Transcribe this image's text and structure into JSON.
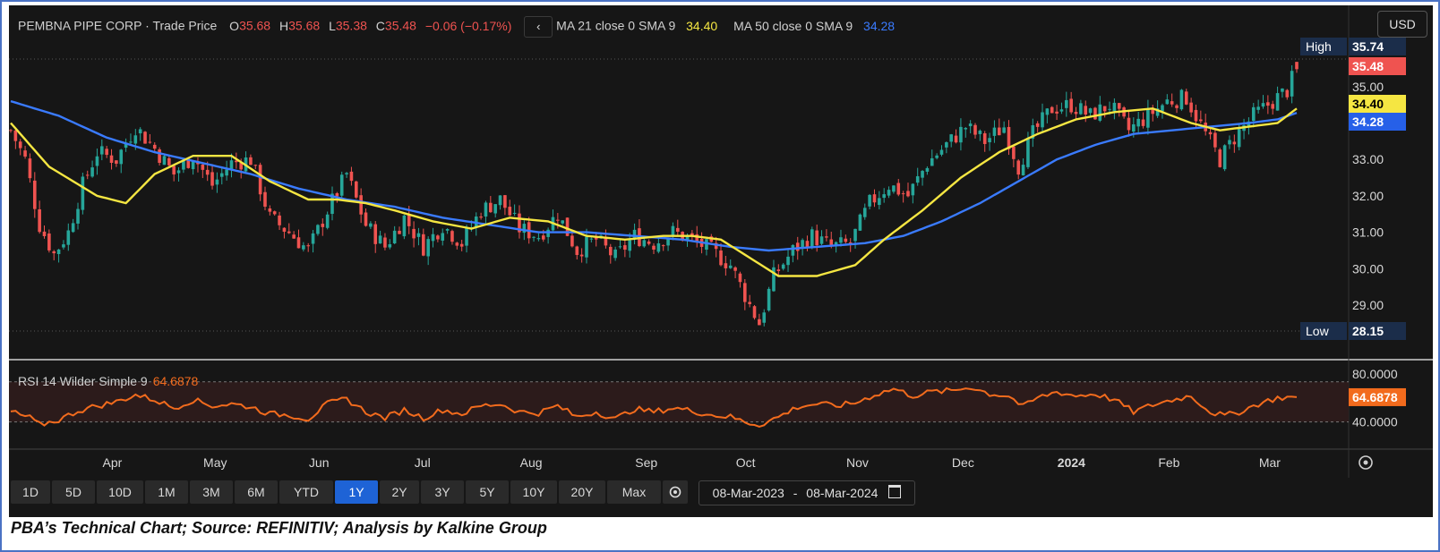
{
  "header": {
    "symbol": "PEMBNA PIPE CORP",
    "price_type": "Trade Price",
    "open_label": "O",
    "open": "35.68",
    "high_label": "H",
    "high": "35.68",
    "low_label": "L",
    "low": "35.38",
    "close_label": "C",
    "close": "35.48",
    "change": "−0.06 (−0.17%)",
    "ma21_label": "MA 21 close 0 SMA 9",
    "ma21_value": "34.40",
    "ma50_label": "MA 50 close 0 SMA 9",
    "ma50_value": "34.28",
    "collapse_glyph": "‹"
  },
  "currency": "USD",
  "price_tags": {
    "high_label": "High",
    "high_value": "35.74",
    "last_value": "35.48",
    "ma21_value": "34.40",
    "ma50_value": "34.28",
    "low_label": "Low",
    "low_value": "28.15"
  },
  "rsi": {
    "label": "RSI 14 Wilder Simple 9",
    "value": "64.6878",
    "upper": "80.0000",
    "lower": "40.0000"
  },
  "toolbar": {
    "ranges": [
      "1D",
      "5D",
      "10D",
      "1M",
      "3M",
      "6M",
      "YTD",
      "1Y",
      "2Y",
      "3Y",
      "5Y",
      "10Y",
      "20Y",
      "Max"
    ],
    "active": "1Y"
  },
  "date_range": {
    "from": "08-Mar-2023",
    "sep": "-",
    "to": "08-Mar-2024"
  },
  "caption": "PBA’s Technical Chart; Source: REFINITIV; Analysis by Kalkine Group",
  "colors": {
    "up": "#26a69a",
    "down": "#ef5350",
    "ma21": "#f5e642",
    "ma50": "#3a7bff",
    "rsi": "#f26b1d",
    "background": "#161616"
  },
  "chart_data": {
    "type": "candlestick",
    "y_ticks": [
      "35.00",
      "34.00",
      "33.00",
      "32.00",
      "31.00",
      "30.00",
      "29.00"
    ],
    "ylim": [
      27.6,
      36.2
    ],
    "x_months": [
      "Apr",
      "May",
      "Jun",
      "Jul",
      "Aug",
      "Sep",
      "Oct",
      "Nov",
      "Dec",
      "2024",
      "Feb",
      "Mar"
    ],
    "price_path": [
      [
        0,
        33.8
      ],
      [
        3,
        33.0
      ],
      [
        6,
        31.2
      ],
      [
        9,
        30.4
      ],
      [
        12,
        31.0
      ],
      [
        15,
        32.3
      ],
      [
        18,
        33.2
      ],
      [
        22,
        33.0
      ],
      [
        26,
        33.9
      ],
      [
        30,
        33.3
      ],
      [
        34,
        32.6
      ],
      [
        38,
        33.1
      ],
      [
        42,
        32.3
      ],
      [
        46,
        32.9
      ],
      [
        50,
        33.0
      ],
      [
        54,
        31.4
      ],
      [
        58,
        31.0
      ],
      [
        62,
        30.5
      ],
      [
        66,
        31.6
      ],
      [
        70,
        32.6
      ],
      [
        74,
        31.2
      ],
      [
        78,
        30.6
      ],
      [
        82,
        31.4
      ],
      [
        86,
        30.6
      ],
      [
        90,
        31.2
      ],
      [
        94,
        30.7
      ],
      [
        98,
        31.6
      ],
      [
        102,
        31.9
      ],
      [
        106,
        31.1
      ],
      [
        110,
        30.9
      ],
      [
        114,
        31.5
      ],
      [
        118,
        30.5
      ],
      [
        122,
        30.8
      ],
      [
        126,
        30.3
      ],
      [
        130,
        30.9
      ],
      [
        134,
        30.7
      ],
      [
        138,
        31.0
      ],
      [
        142,
        30.8
      ],
      [
        146,
        30.5
      ],
      [
        150,
        30.1
      ],
      [
        154,
        29.0
      ],
      [
        156,
        28.5
      ],
      [
        159,
        29.8
      ],
      [
        163,
        30.5
      ],
      [
        167,
        30.9
      ],
      [
        171,
        30.6
      ],
      [
        175,
        30.7
      ],
      [
        179,
        31.8
      ],
      [
        183,
        32.3
      ],
      [
        187,
        32.0
      ],
      [
        191,
        32.9
      ],
      [
        195,
        33.4
      ],
      [
        199,
        33.9
      ],
      [
        203,
        33.5
      ],
      [
        207,
        33.9
      ],
      [
        210,
        32.8
      ],
      [
        213,
        33.7
      ],
      [
        217,
        34.4
      ],
      [
        221,
        34.5
      ],
      [
        225,
        34.2
      ],
      [
        229,
        34.5
      ],
      [
        233,
        33.8
      ],
      [
        237,
        34.2
      ],
      [
        241,
        34.6
      ],
      [
        245,
        34.7
      ],
      [
        249,
        33.7
      ],
      [
        252,
        33.0
      ],
      [
        255,
        33.6
      ],
      [
        259,
        34.2
      ],
      [
        263,
        34.6
      ],
      [
        266,
        34.9
      ],
      [
        268,
        35.48
      ]
    ],
    "ma21_path": [
      [
        0,
        34.0
      ],
      [
        8,
        32.8
      ],
      [
        18,
        32.0
      ],
      [
        24,
        31.8
      ],
      [
        30,
        32.6
      ],
      [
        38,
        33.1
      ],
      [
        46,
        33.1
      ],
      [
        54,
        32.4
      ],
      [
        62,
        31.9
      ],
      [
        68,
        31.9
      ],
      [
        74,
        31.8
      ],
      [
        80,
        31.6
      ],
      [
        88,
        31.3
      ],
      [
        96,
        31.1
      ],
      [
        104,
        31.4
      ],
      [
        112,
        31.3
      ],
      [
        120,
        30.9
      ],
      [
        128,
        30.8
      ],
      [
        136,
        30.9
      ],
      [
        142,
        30.9
      ],
      [
        148,
        30.8
      ],
      [
        154,
        30.3
      ],
      [
        160,
        29.8
      ],
      [
        168,
        29.8
      ],
      [
        176,
        30.1
      ],
      [
        182,
        30.8
      ],
      [
        190,
        31.6
      ],
      [
        198,
        32.5
      ],
      [
        206,
        33.2
      ],
      [
        214,
        33.7
      ],
      [
        222,
        34.1
      ],
      [
        230,
        34.3
      ],
      [
        238,
        34.4
      ],
      [
        246,
        34.0
      ],
      [
        252,
        33.8
      ],
      [
        258,
        33.9
      ],
      [
        264,
        34.0
      ],
      [
        268,
        34.4
      ]
    ],
    "ma50_path": [
      [
        0,
        34.6
      ],
      [
        10,
        34.2
      ],
      [
        20,
        33.6
      ],
      [
        30,
        33.2
      ],
      [
        40,
        32.9
      ],
      [
        50,
        32.6
      ],
      [
        60,
        32.2
      ],
      [
        70,
        31.9
      ],
      [
        80,
        31.7
      ],
      [
        90,
        31.4
      ],
      [
        100,
        31.2
      ],
      [
        110,
        31.0
      ],
      [
        120,
        31.0
      ],
      [
        130,
        30.9
      ],
      [
        140,
        30.8
      ],
      [
        150,
        30.6
      ],
      [
        158,
        30.5
      ],
      [
        168,
        30.6
      ],
      [
        178,
        30.7
      ],
      [
        186,
        30.9
      ],
      [
        194,
        31.3
      ],
      [
        202,
        31.8
      ],
      [
        210,
        32.4
      ],
      [
        218,
        33.0
      ],
      [
        226,
        33.4
      ],
      [
        234,
        33.7
      ],
      [
        242,
        33.8
      ],
      [
        250,
        33.9
      ],
      [
        258,
        34.0
      ],
      [
        264,
        34.1
      ],
      [
        268,
        34.28
      ]
    ],
    "rsi_path": [
      [
        0,
        50
      ],
      [
        4,
        44
      ],
      [
        6,
        37
      ],
      [
        10,
        42
      ],
      [
        14,
        51
      ],
      [
        18,
        56
      ],
      [
        22,
        60
      ],
      [
        26,
        67
      ],
      [
        30,
        62
      ],
      [
        34,
        54
      ],
      [
        38,
        62
      ],
      [
        42,
        56
      ],
      [
        46,
        58
      ],
      [
        50,
        55
      ],
      [
        54,
        48
      ],
      [
        58,
        47
      ],
      [
        62,
        43
      ],
      [
        66,
        58
      ],
      [
        70,
        63
      ],
      [
        74,
        50
      ],
      [
        78,
        44
      ],
      [
        82,
        52
      ],
      [
        86,
        44
      ],
      [
        90,
        52
      ],
      [
        94,
        48
      ],
      [
        98,
        56
      ],
      [
        102,
        58
      ],
      [
        106,
        50
      ],
      [
        110,
        49
      ],
      [
        114,
        56
      ],
      [
        118,
        45
      ],
      [
        122,
        50
      ],
      [
        126,
        43
      ],
      [
        130,
        53
      ],
      [
        134,
        50
      ],
      [
        138,
        54
      ],
      [
        142,
        51
      ],
      [
        146,
        47
      ],
      [
        150,
        45
      ],
      [
        153,
        40
      ],
      [
        156,
        37
      ],
      [
        160,
        45
      ],
      [
        164,
        55
      ],
      [
        168,
        58
      ],
      [
        172,
        56
      ],
      [
        176,
        59
      ],
      [
        180,
        67
      ],
      [
        184,
        73
      ],
      [
        188,
        66
      ],
      [
        192,
        70
      ],
      [
        196,
        71
      ],
      [
        200,
        75
      ],
      [
        204,
        68
      ],
      [
        208,
        66
      ],
      [
        211,
        55
      ],
      [
        214,
        64
      ],
      [
        218,
        70
      ],
      [
        222,
        66
      ],
      [
        226,
        68
      ],
      [
        230,
        62
      ],
      [
        234,
        50
      ],
      [
        238,
        57
      ],
      [
        242,
        62
      ],
      [
        246,
        66
      ],
      [
        250,
        50
      ],
      [
        253,
        46
      ],
      [
        256,
        50
      ],
      [
        260,
        58
      ],
      [
        264,
        64
      ],
      [
        268,
        64.69
      ]
    ]
  }
}
